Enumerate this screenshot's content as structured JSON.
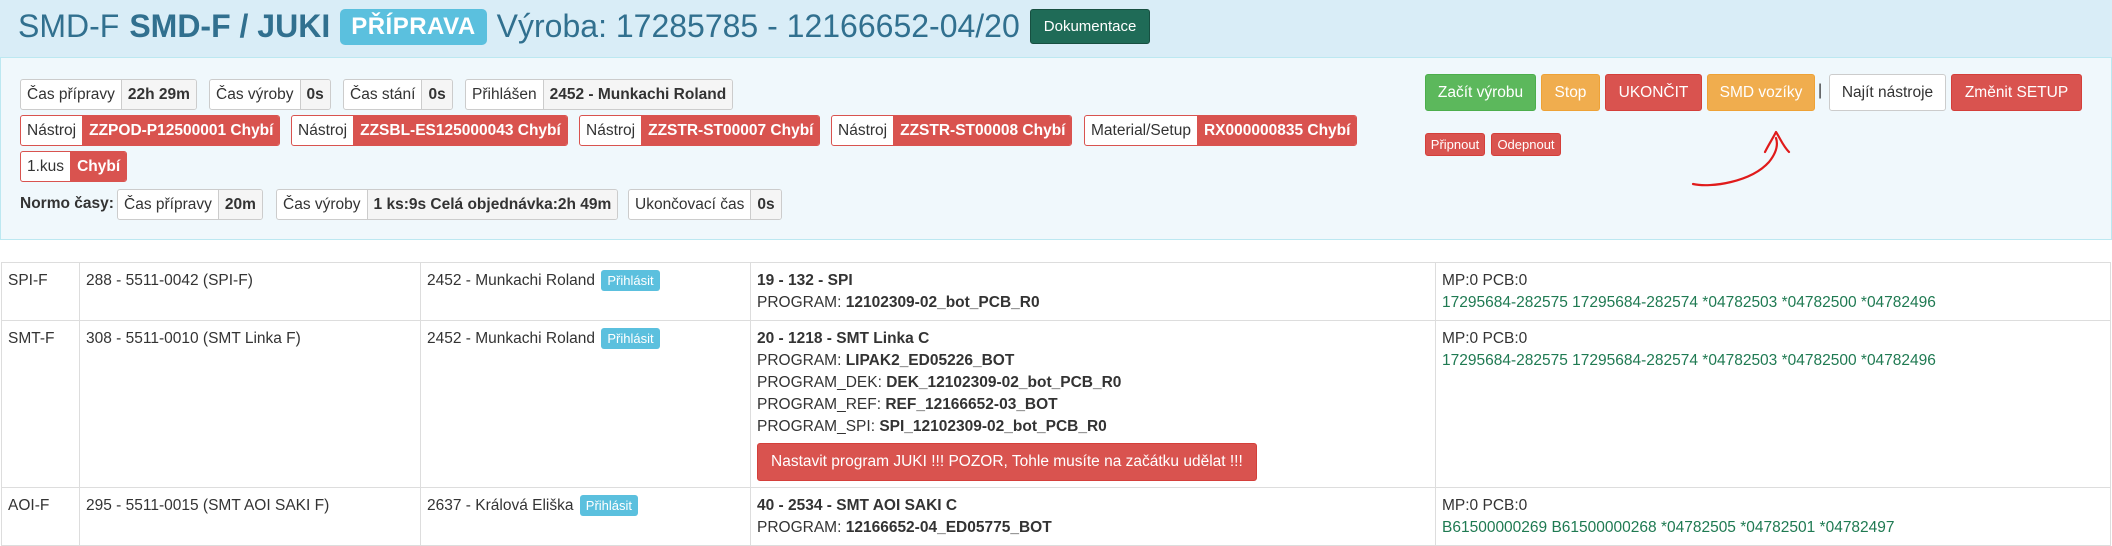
{
  "header": {
    "prefix": "SMD-F",
    "title": "SMD-F / JUKI",
    "status_badge": "PŘÍPRAVA",
    "order": "Výroba: 17285785 - 12166652-04/20",
    "doc_button": "Dokumentace"
  },
  "info_pills": [
    {
      "label": "Čas přípravy",
      "value": "22h 29m"
    },
    {
      "label": "Čas výroby",
      "value": "0s"
    },
    {
      "label": "Čas stání",
      "value": "0s"
    },
    {
      "label": "Přihlášen",
      "value": "2452 - Munkachi Roland"
    }
  ],
  "missing_tools": [
    {
      "label": "Nástroj",
      "value": "ZZPOD-P12500001 Chybí"
    },
    {
      "label": "Nástroj",
      "value": "ZZSBL-ES125000043 Chybí"
    },
    {
      "label": "Nástroj",
      "value": "ZZSTR-ST00007 Chybí"
    },
    {
      "label": "Nástroj",
      "value": "ZZSTR-ST00008 Chybí"
    },
    {
      "label": "Material/Setup",
      "value": "RX000000835 Chybí"
    }
  ],
  "first_piece": {
    "label": "1.kus",
    "value": "Chybí"
  },
  "normo": {
    "label": "Normo časy:",
    "items": [
      {
        "label": "Čas přípravy",
        "value": "20m"
      },
      {
        "label": "Čas výroby",
        "value": "1 ks:9s Celá objednávka:2h 49m"
      },
      {
        "label": "Ukončovací čas",
        "value": "0s"
      }
    ]
  },
  "actions": {
    "start": "Začít výrobu",
    "stop": "Stop",
    "finish": "UKONČIT",
    "smd_carts": "SMD vozíky",
    "separator": "|",
    "find_tools": "Najít nástroje",
    "change_setup": "Změnit SETUP",
    "attach": "Připnout",
    "detach": "Odepnout"
  },
  "colors": {
    "header_bg": "#d9edf7",
    "header_text": "#31708f",
    "danger": "#d9534f",
    "success": "#5cb85c",
    "warning": "#f0ad4e",
    "info": "#5bc0de",
    "dark_green": "#1f6b57"
  },
  "operations": [
    {
      "code": "SPI-F",
      "machine": "288 - 5511-0042 (SPI-F)",
      "operator": "2452 - Munkachi Roland",
      "login_label": "Přihlásit",
      "station": "19 - 132 - SPI",
      "programs": [
        {
          "key": "PROGRAM:",
          "value": "12102309-02_bot_PCB_R0"
        }
      ],
      "alert": "",
      "counters": "MP:0 PCB:0",
      "serials": "17295684-282575 17295684-282574 *04782503 *04782500 *04782496"
    },
    {
      "code": "SMT-F",
      "machine": "308 - 5511-0010 (SMT Linka F)",
      "operator": "2452 - Munkachi Roland",
      "login_label": "Přihlásit",
      "station": "20 - 1218 - SMT Linka C",
      "programs": [
        {
          "key": "PROGRAM:",
          "value": "LIPAK2_ED05226_BOT"
        },
        {
          "key": "PROGRAM_DEK:",
          "value": "DEK_12102309-02_bot_PCB_R0"
        },
        {
          "key": "PROGRAM_REF:",
          "value": "REF_12166652-03_BOT"
        },
        {
          "key": "PROGRAM_SPI:",
          "value": "SPI_12102309-02_bot_PCB_R0"
        }
      ],
      "alert": "Nastavit program JUKI !!! POZOR, Tohle musíte na začátku udělat !!!",
      "counters": "MP:0 PCB:0",
      "serials": "17295684-282575 17295684-282574 *04782503 *04782500 *04782496"
    },
    {
      "code": "AOI-F",
      "machine": "295 - 5511-0015 (SMT AOI SAKI F)",
      "operator": "2637 - Králová Eliška",
      "login_label": "Přihlásit",
      "station": "40 - 2534 - SMT AOI SAKI C",
      "programs": [
        {
          "key": "PROGRAM:",
          "value": "12166652-04_ED05775_BOT"
        }
      ],
      "alert": "",
      "counters": "MP:0 PCB:0",
      "serials": "B61500000269 B61500000268 *04782505 *04782501 *04782497"
    }
  ]
}
